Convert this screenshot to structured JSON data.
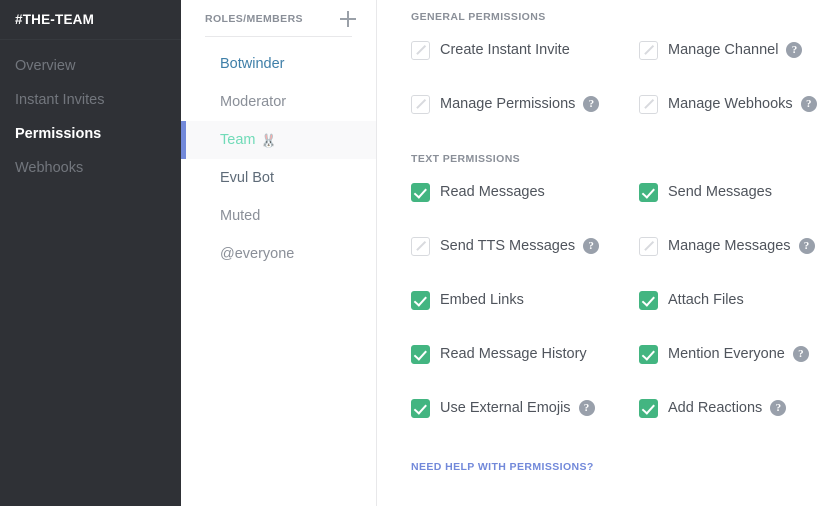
{
  "sidebar": {
    "channel_title": "#THE-TEAM",
    "items": [
      {
        "label": "Overview",
        "active": false
      },
      {
        "label": "Instant Invites",
        "active": false
      },
      {
        "label": "Permissions",
        "active": true
      },
      {
        "label": "Webhooks",
        "active": false
      }
    ]
  },
  "roles_panel": {
    "header_label": "ROLES/MEMBERS",
    "add_icon": "plus-icon",
    "items": [
      {
        "label": "Botwinder",
        "color": "#3f7fa8",
        "selected": false,
        "emoji": ""
      },
      {
        "label": "Moderator",
        "color": "#8a8f98",
        "selected": false,
        "emoji": ""
      },
      {
        "label": "Team",
        "color": "#71dbb8",
        "selected": true,
        "emoji": "🐰"
      },
      {
        "label": "Evul Bot",
        "color": "#5e6b78",
        "selected": false,
        "emoji": ""
      },
      {
        "label": "Muted",
        "color": "#8a8f98",
        "selected": false,
        "emoji": ""
      },
      {
        "label": "@everyone",
        "color": "#8a8f98",
        "selected": false,
        "emoji": ""
      }
    ]
  },
  "main": {
    "general_section_label": "GENERAL PERMISSIONS",
    "general_permissions": [
      {
        "label": "Create Instant Invite",
        "state": "neutral",
        "help": false
      },
      {
        "label": "Manage Channel",
        "state": "neutral",
        "help": true
      },
      {
        "label": "Manage Permissions",
        "state": "neutral",
        "help": true
      },
      {
        "label": "Manage Webhooks",
        "state": "neutral",
        "help": true
      }
    ],
    "text_section_label": "TEXT PERMISSIONS",
    "text_permissions": [
      {
        "label": "Read Messages",
        "state": "checked",
        "help": false
      },
      {
        "label": "Send Messages",
        "state": "checked",
        "help": false
      },
      {
        "label": "Send TTS Messages",
        "state": "neutral",
        "help": true
      },
      {
        "label": "Manage Messages",
        "state": "neutral",
        "help": true
      },
      {
        "label": "Embed Links",
        "state": "checked",
        "help": false
      },
      {
        "label": "Attach Files",
        "state": "checked",
        "help": false
      },
      {
        "label": "Read Message History",
        "state": "checked",
        "help": false
      },
      {
        "label": "Mention Everyone",
        "state": "checked",
        "help": true
      },
      {
        "label": "Use External Emojis",
        "state": "checked",
        "help": true
      },
      {
        "label": "Add Reactions",
        "state": "checked",
        "help": true
      }
    ],
    "help_footer_label": "NEED HELP WITH PERMISSIONS?",
    "help_glyph": "?"
  },
  "colors": {
    "sidebar_bg": "#2f3136",
    "accent_blurple": "#7289da",
    "checked_green": "#43b581",
    "muted_text": "#8a8f98"
  }
}
